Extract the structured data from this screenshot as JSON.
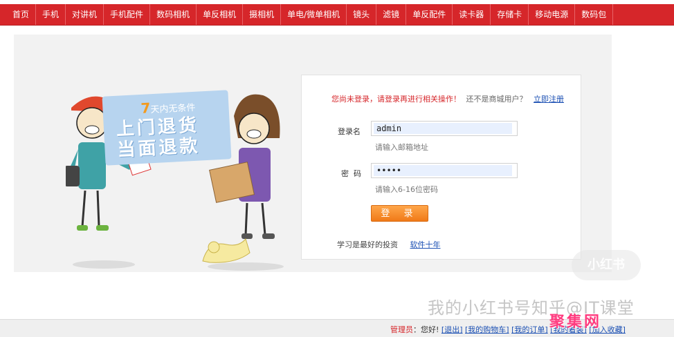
{
  "nav": {
    "items": [
      "首页",
      "手机",
      "对讲机",
      "手机配件",
      "数码相机",
      "单反相机",
      "摄相机",
      "单电/微单相机",
      "镜头",
      "滤镜",
      "单反配件",
      "读卡器",
      "存储卡",
      "移动电源",
      "数码包"
    ]
  },
  "banner": {
    "days": "7",
    "condition": "天内无条件",
    "line2": "上门退货",
    "line3": "当面退款"
  },
  "login": {
    "notice_warn": "您尚未登录，请登录再进行相关操作！",
    "notice_question": "还不是商城用户？",
    "register_link": "立即注册",
    "username_label": "登录名",
    "username_value": "admin",
    "username_hint": "请输入邮箱地址",
    "password_label": "密  码",
    "password_value": "•••••",
    "password_hint": "请输入6-16位密码",
    "submit_label": "登 录",
    "footer_text": "学习是最好的投资",
    "footer_link": "软件十年"
  },
  "bottom": {
    "user": "管理员",
    "greeting": "：您好!",
    "links": [
      "[退出]",
      "[我的购物车]",
      "[我的订单]",
      "[我的着装]",
      "[加入收藏]"
    ]
  },
  "watermarks": {
    "badge": "小红书",
    "caption": "我的小红书号知乎@IT课堂",
    "corner": "聚集网"
  },
  "colors": {
    "nav_red": "#d6262a",
    "button_orange": "#f07a18",
    "link_blue": "#1a4fb3",
    "stage_grey": "#f2f2f2"
  }
}
